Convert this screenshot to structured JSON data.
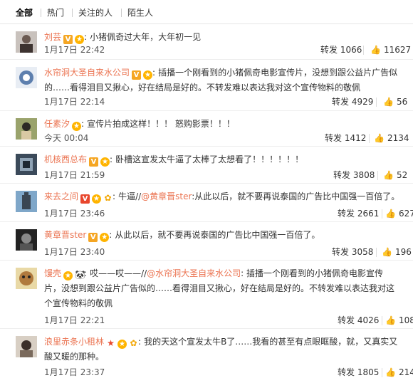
{
  "tabs": [
    "全部",
    "热门",
    "关注的人",
    "陌生人"
  ],
  "comments": [
    {
      "name": "刘芸",
      "text": "小猪佩奇过大年，大年初一见",
      "time": "1月17日 22:42",
      "repost": "转发 1066",
      "likes": "11627"
    },
    {
      "name": "水帘洞大圣自来水公司",
      "text": "插播一个刚看到的小猪佩奇电影宣传片，没想到跟公益片广告似的……看得泪目又揪心，好在结局是好的。不转发难以表达我对这个宣传物料的敬佩",
      "time": "1月17日 22:14",
      "repost": "转发 4929",
      "likes": "56"
    },
    {
      "name": "任素汐",
      "text": "宣传片拍成这样！！！ 怒购影票！！！",
      "time": "今天 00:04",
      "repost": "转发 1412",
      "likes": "2134"
    },
    {
      "name": "机核西总布",
      "text": "卧槽这宣发太牛逼了太棒了太想看了！！！！！！",
      "time": "1月17日 21:59",
      "repost": "转发 3808",
      "likes": "52"
    },
    {
      "name": "来去之间",
      "text": "牛逼//@黄章晋ster:从此以后，就不要再说泰国的广告比中国强一百倍了。",
      "mention": "@黄章晋ster",
      "time": "1月17日 23:46",
      "repost": "转发 2661",
      "likes": "627"
    },
    {
      "name": "黄章晋ster",
      "text": "从此以后，就不要再说泰国的广告比中国强一百倍了。",
      "time": "1月17日 23:40",
      "repost": "转发 3058",
      "likes": "196"
    },
    {
      "name": "馒壳",
      "text": "哎——哎——//@水帘洞大圣自来水公司: 插播一个刚看到的小猪佩奇电影宣传片，没想到跟公益片广告似的……看得泪目又揪心，好在结局是好的。不转发难以表达我对这个宣传物料的敬佩",
      "time": "1月17日 22:21",
      "repost": "转发 4026",
      "likes": "108"
    },
    {
      "name": "浪里赤条小租林",
      "text": "我的天这个宣发太牛B了……我看的甚至有点眼眶酸，就，又真实又酸又暖的那种。",
      "time": "1月17日 23:37",
      "repost": "转发 1805",
      "likes": "214"
    }
  ],
  "icons": {
    "like": "thumbs-up-icon",
    "vip": "vip-badge-icon",
    "level": "level-badge-icon"
  },
  "colors": {
    "name": "#eb7350",
    "text": "#333333",
    "gold": "#f5a623",
    "red": "#e8462d"
  }
}
